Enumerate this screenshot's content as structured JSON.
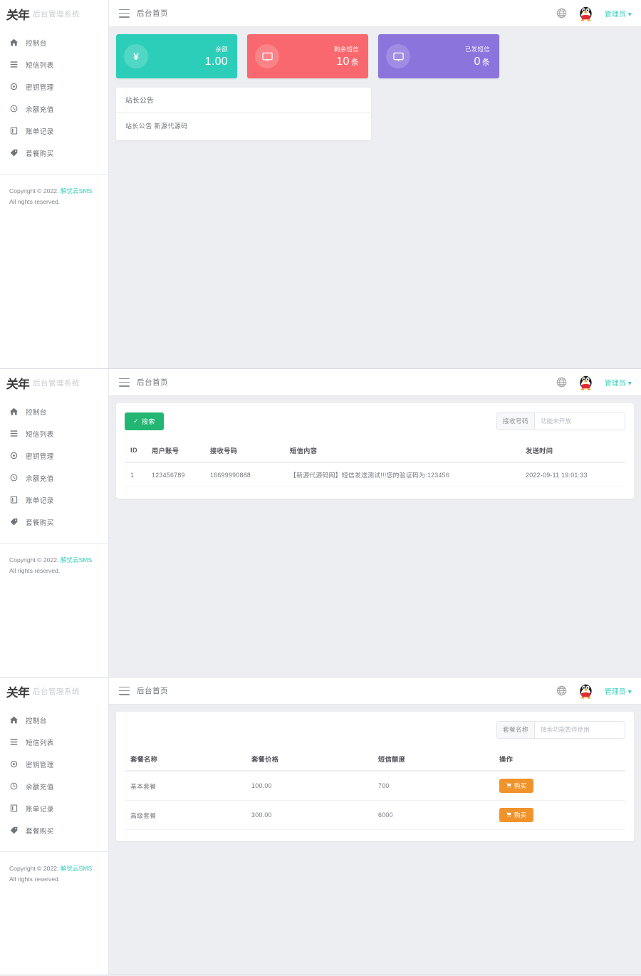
{
  "brand": {
    "logo_text": "关年",
    "subtitle": "后台管理系统"
  },
  "topbar": {
    "title": "后台首页",
    "user_label": "管理员 ▾",
    "hamburger_icon": "hamburger-icon",
    "lang_icon": "language-globe-icon",
    "avatar_icon": "qq-penguin-avatar"
  },
  "sidebar": {
    "items": [
      {
        "label": "控制台",
        "icon": "home-icon"
      },
      {
        "label": "短信列表",
        "icon": "list-icon"
      },
      {
        "label": "密钥管理",
        "icon": "key-gear-icon"
      },
      {
        "label": "余额充值",
        "icon": "clock-icon"
      },
      {
        "label": "账单记录",
        "icon": "book-icon"
      },
      {
        "label": "套餐购买",
        "icon": "tag-icon"
      }
    ]
  },
  "footer": {
    "copyright_prefix": "Copyright © 2022.",
    "link": "解忧云SMS",
    "rights": "All rights reserved."
  },
  "dashboard": {
    "cards": [
      {
        "label": "余额",
        "value": "1.00",
        "unit": "",
        "color": "#2dceb9",
        "icon": "yen-icon"
      },
      {
        "label": "剩余短信",
        "value": "10",
        "unit": "条",
        "color": "#f9686e",
        "icon": "message-icon"
      },
      {
        "label": "已发短信",
        "value": "0",
        "unit": "条",
        "color": "#8c74dd",
        "icon": "message-icon"
      }
    ],
    "announcement": {
      "title": "站长公告",
      "body": "站长公告 新源代源码"
    }
  },
  "sms_page": {
    "search_button": "搜索",
    "search_check_icon": "check-icon",
    "filter_label": "接收号码",
    "filter_placeholder": "功能未开放",
    "filter_value": "",
    "columns": [
      "ID",
      "用户账号",
      "接收号码",
      "短信内容",
      "发送时间"
    ],
    "rows": [
      {
        "id": "1",
        "account": "123456789",
        "phone": "16699990888",
        "content": "【新源代源码网】短信发送测试!!!您的验证码为:123456",
        "time": "2022-09-11 19:01:33"
      }
    ]
  },
  "package_page": {
    "filter_label": "套餐名称",
    "filter_placeholder": "搜索功能暂停使用",
    "filter_value": "",
    "columns": [
      "套餐名称",
      "套餐价格",
      "短信额度",
      "操作"
    ],
    "rows": [
      {
        "name": "基本套餐",
        "price": "100.00",
        "quota": "700",
        "action": "购买"
      },
      {
        "name": "高级套餐",
        "price": "300.00",
        "quota": "6000",
        "action": "购买"
      }
    ],
    "buy_icon": "cart-icon"
  }
}
